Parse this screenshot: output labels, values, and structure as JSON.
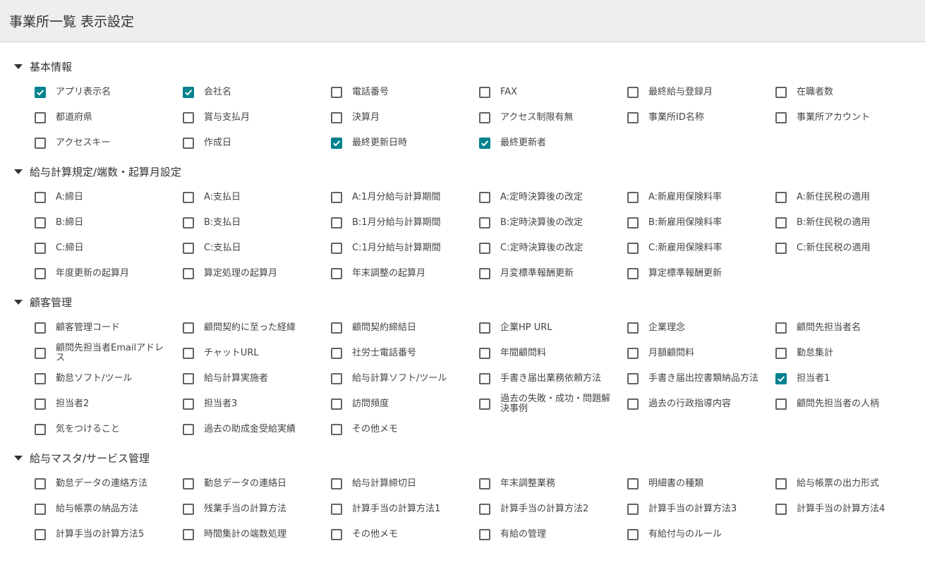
{
  "header": {
    "title": "事業所一覧 表示設定"
  },
  "colors": {
    "check_accent": "#00838f",
    "header_bg": "#eeeeee"
  },
  "sections": [
    {
      "label": "基本情報",
      "items": [
        {
          "label": "アプリ表示名",
          "checked": true
        },
        {
          "label": "会社名",
          "checked": true
        },
        {
          "label": "電話番号",
          "checked": false
        },
        {
          "label": "FAX",
          "checked": false
        },
        {
          "label": "最終給与登録月",
          "checked": false
        },
        {
          "label": "在職者数",
          "checked": false
        },
        {
          "label": "都道府県",
          "checked": false
        },
        {
          "label": "賞与支払月",
          "checked": false
        },
        {
          "label": "決算月",
          "checked": false
        },
        {
          "label": "アクセス制限有無",
          "checked": false
        },
        {
          "label": "事業所ID名称",
          "checked": false
        },
        {
          "label": "事業所アカウント",
          "checked": false
        },
        {
          "label": "アクセスキー",
          "checked": false
        },
        {
          "label": "作成日",
          "checked": false
        },
        {
          "label": "最終更新日時",
          "checked": true
        },
        {
          "label": "最終更新者",
          "checked": true
        }
      ]
    },
    {
      "label": "給与計算規定/端数・起算月設定",
      "items": [
        {
          "label": "A:締日",
          "checked": false
        },
        {
          "label": "A:支払日",
          "checked": false
        },
        {
          "label": "A:1月分給与計算期間",
          "checked": false
        },
        {
          "label": "A:定時決算後の改定",
          "checked": false
        },
        {
          "label": "A:新雇用保険料率",
          "checked": false
        },
        {
          "label": "A:新住民税の適用",
          "checked": false
        },
        {
          "label": "B:締日",
          "checked": false
        },
        {
          "label": "B:支払日",
          "checked": false
        },
        {
          "label": "B:1月分給与計算期間",
          "checked": false
        },
        {
          "label": "B:定時決算後の改定",
          "checked": false
        },
        {
          "label": "B:新雇用保険料率",
          "checked": false
        },
        {
          "label": "B:新住民税の適用",
          "checked": false
        },
        {
          "label": "C:締日",
          "checked": false
        },
        {
          "label": "C:支払日",
          "checked": false
        },
        {
          "label": "C:1月分給与計算期間",
          "checked": false
        },
        {
          "label": "C:定時決算後の改定",
          "checked": false
        },
        {
          "label": "C:新雇用保険料率",
          "checked": false
        },
        {
          "label": "C:新住民税の適用",
          "checked": false
        },
        {
          "label": "年度更新の起算月",
          "checked": false
        },
        {
          "label": "算定処理の起算月",
          "checked": false
        },
        {
          "label": "年末調整の起算月",
          "checked": false
        },
        {
          "label": "月変標準報酬更新",
          "checked": false
        },
        {
          "label": "算定標準報酬更新",
          "checked": false
        }
      ]
    },
    {
      "label": "顧客管理",
      "items": [
        {
          "label": "顧客管理コード",
          "checked": false
        },
        {
          "label": "顧問契約に至った経緯",
          "checked": false
        },
        {
          "label": "顧問契約締結日",
          "checked": false
        },
        {
          "label": "企業HP URL",
          "checked": false
        },
        {
          "label": "企業理念",
          "checked": false
        },
        {
          "label": "顧問先担当者名",
          "checked": false
        },
        {
          "label": "顧問先担当者Emailアドレス",
          "checked": false
        },
        {
          "label": "チャットURL",
          "checked": false
        },
        {
          "label": "社労士電話番号",
          "checked": false
        },
        {
          "label": "年間顧問料",
          "checked": false
        },
        {
          "label": "月額顧問料",
          "checked": false
        },
        {
          "label": "勤怠集計",
          "checked": false
        },
        {
          "label": "勤怠ソフト/ツール",
          "checked": false
        },
        {
          "label": "給与計算実施者",
          "checked": false
        },
        {
          "label": "給与計算ソフト/ツール",
          "checked": false
        },
        {
          "label": "手書き届出業務依頼方法",
          "checked": false
        },
        {
          "label": "手書き届出控書類納品方法",
          "checked": false
        },
        {
          "label": "担当者1",
          "checked": true
        },
        {
          "label": "担当者2",
          "checked": false
        },
        {
          "label": "担当者3",
          "checked": false
        },
        {
          "label": "訪問頻度",
          "checked": false
        },
        {
          "label": "過去の失敗・成功・問題解決事例",
          "checked": false
        },
        {
          "label": "過去の行政指導内容",
          "checked": false
        },
        {
          "label": "顧問先担当者の人柄",
          "checked": false
        },
        {
          "label": "気をつけること",
          "checked": false
        },
        {
          "label": "過去の助成金受給実績",
          "checked": false
        },
        {
          "label": "その他メモ",
          "checked": false
        }
      ]
    },
    {
      "label": "給与マスタ/サービス管理",
      "items": [
        {
          "label": "勤怠データの連絡方法",
          "checked": false
        },
        {
          "label": "勤怠データの連絡日",
          "checked": false
        },
        {
          "label": "給与計算締切日",
          "checked": false
        },
        {
          "label": "年末調整業務",
          "checked": false
        },
        {
          "label": "明細書の種類",
          "checked": false
        },
        {
          "label": "給与帳票の出力形式",
          "checked": false
        },
        {
          "label": "給与帳票の納品方法",
          "checked": false
        },
        {
          "label": "残業手当の計算方法",
          "checked": false
        },
        {
          "label": "計算手当の計算方法1",
          "checked": false
        },
        {
          "label": "計算手当の計算方法2",
          "checked": false
        },
        {
          "label": "計算手当の計算方法3",
          "checked": false
        },
        {
          "label": "計算手当の計算方法4",
          "checked": false
        },
        {
          "label": "計算手当の計算方法5",
          "checked": false
        },
        {
          "label": "時間集計の端数処理",
          "checked": false
        },
        {
          "label": "その他メモ",
          "checked": false
        },
        {
          "label": "有給の管理",
          "checked": false
        },
        {
          "label": "有給付与のルール",
          "checked": false
        }
      ]
    }
  ]
}
